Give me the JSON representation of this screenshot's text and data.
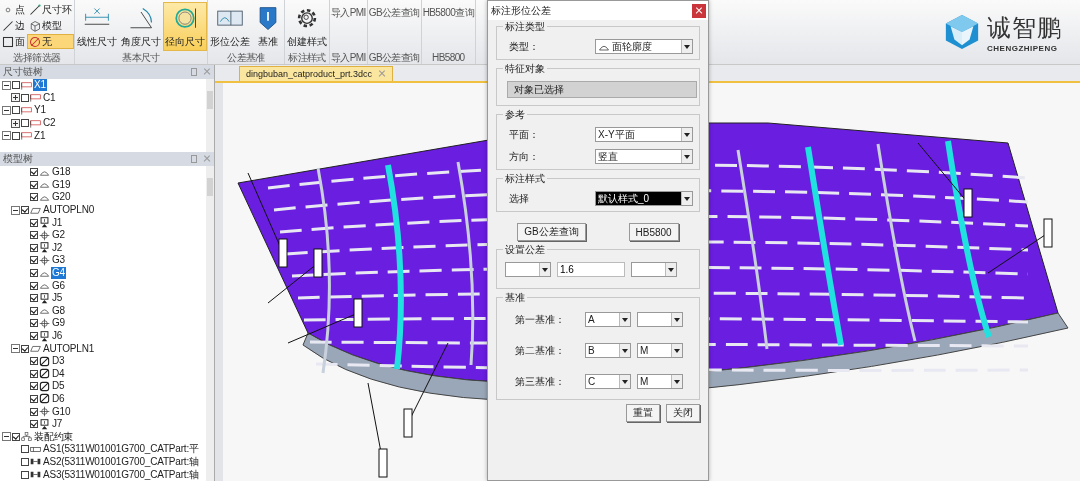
{
  "ribbon": {
    "groups": [
      {
        "label": "选择筛选器",
        "kind": "filter",
        "items": [
          {
            "label": "点",
            "kind": "point",
            "selected": false
          },
          {
            "label": "尺寸环",
            "kind": "line",
            "selected": false
          },
          {
            "label": "边",
            "kind": "edge",
            "selected": false
          },
          {
            "label": "模型",
            "kind": "cube",
            "selected": false
          },
          {
            "label": "面",
            "kind": "face",
            "selected": false
          },
          {
            "label": "无",
            "kind": "none",
            "selected": true
          }
        ]
      },
      {
        "label": "基本尺寸",
        "kind": "large",
        "items": [
          {
            "label": "线性尺寸",
            "kind": "linear",
            "selected": false
          },
          {
            "label": "角度尺寸",
            "kind": "angle",
            "selected": false
          },
          {
            "label": "径向尺寸",
            "kind": "radial",
            "selected": true
          }
        ]
      },
      {
        "label": "公差基准",
        "kind": "large",
        "items": [
          {
            "label": "形位公差",
            "kind": "tolerance",
            "selected": false
          },
          {
            "label": "基准",
            "kind": "datum",
            "selected": false
          }
        ]
      },
      {
        "label": "标注样式",
        "kind": "large",
        "items": [
          {
            "label": "创建样式",
            "kind": "gear",
            "selected": false
          }
        ]
      },
      {
        "label": "导入PMI",
        "kind": "text",
        "items": [
          {
            "label": "导入PMI"
          }
        ]
      },
      {
        "label": "GB公差查询",
        "kind": "text",
        "items": [
          {
            "label": "GB公差查询"
          }
        ]
      },
      {
        "label": "HB5800",
        "kind": "text",
        "items": [
          {
            "label": "HB5800查询"
          }
        ]
      }
    ]
  },
  "logo": {
    "name": "诚智鹏",
    "subtitle": "CHENGZHIPENG"
  },
  "dimension_tree": {
    "title": "尺寸链树",
    "items": [
      {
        "label": "X1",
        "kind": "flag",
        "checked": false,
        "selected": true,
        "expanded": true,
        "children": [
          {
            "label": "C1",
            "kind": "flag",
            "checked": false,
            "selected": false,
            "expanded": false
          }
        ]
      },
      {
        "label": "Y1",
        "kind": "flag",
        "checked": false,
        "selected": false,
        "expanded": true,
        "children": [
          {
            "label": "C2",
            "kind": "flag",
            "checked": false,
            "selected": false,
            "expanded": false
          }
        ]
      },
      {
        "label": "Z1",
        "kind": "flag",
        "checked": false,
        "selected": false,
        "expanded": true
      }
    ]
  },
  "model_tree": {
    "title": "模型树",
    "items": [
      {
        "children": [
          {
            "children": [
              {
                "label": "G18",
                "kind": "profile",
                "checked": true,
                "selected": false
              },
              {
                "label": "G19",
                "kind": "profile",
                "checked": true,
                "selected": false
              },
              {
                "label": "G20",
                "kind": "profile",
                "checked": true,
                "selected": false
              }
            ]
          },
          {
            "label": "AUTOPLN0",
            "kind": "plane",
            "checked": true,
            "selected": false,
            "expanded": true,
            "children": [
              {
                "label": "J1",
                "kind": "datum",
                "checked": true,
                "selected": false
              },
              {
                "label": "G2",
                "kind": "position",
                "checked": true,
                "selected": false
              },
              {
                "label": "J2",
                "kind": "datum",
                "checked": true,
                "selected": false
              },
              {
                "label": "G3",
                "kind": "position",
                "checked": true,
                "selected": false
              },
              {
                "label": "G4",
                "kind": "profile",
                "checked": true,
                "selected": true
              },
              {
                "label": "G6",
                "kind": "profile",
                "checked": true,
                "selected": false
              },
              {
                "label": "J5",
                "kind": "datum",
                "checked": true,
                "selected": false
              },
              {
                "label": "G8",
                "kind": "profile",
                "checked": true,
                "selected": false
              },
              {
                "label": "G9",
                "kind": "position",
                "checked": true,
                "selected": false
              },
              {
                "label": "J6",
                "kind": "datum",
                "checked": true,
                "selected": false
              }
            ]
          },
          {
            "label": "AUTOPLN1",
            "kind": "plane",
            "checked": true,
            "selected": false,
            "expanded": true,
            "children": [
              {
                "label": "D3",
                "kind": "flatness",
                "checked": true,
                "selected": false
              },
              {
                "label": "D4",
                "kind": "flatness",
                "checked": true,
                "selected": false
              },
              {
                "label": "D5",
                "kind": "flatness",
                "checked": true,
                "selected": false
              },
              {
                "label": "D6",
                "kind": "flatness",
                "checked": true,
                "selected": false
              },
              {
                "label": "G10",
                "kind": "position",
                "checked": true,
                "selected": false
              },
              {
                "label": "J7",
                "kind": "datum",
                "checked": true,
                "selected": false
              }
            ]
          }
        ]
      },
      {
        "label": "装配约束",
        "kind": "assembly",
        "checked": true,
        "selected": false,
        "expanded": true,
        "children": [
          {
            "label": "AS1(5311W01001G700_CATPart:平",
            "kind": "flat_constraint",
            "checked": false,
            "selected": false
          },
          {
            "label": "AS2(5311W01001G700_CATPart:轴",
            "kind": "axis_constraint",
            "checked": false,
            "selected": false
          },
          {
            "label": "AS3(5311W01001G700_CATPart:轴",
            "kind": "axis_constraint",
            "checked": false,
            "selected": false
          }
        ]
      }
    ]
  },
  "document_tab": {
    "label": "dingbuban_catproduct_prt.3dcc",
    "selected": true
  },
  "dialog": {
    "title": "标注形位公差",
    "annotation_type": {
      "title": "标注类型",
      "label": "类型：",
      "value": "面轮廓度"
    },
    "feature": {
      "title": "特征对象",
      "button": "对象已选择"
    },
    "reference": {
      "title": "参考",
      "rows": [
        {
          "label": "平面：",
          "value": "X-Y平面"
        },
        {
          "label": "方向：",
          "value": "竖直"
        }
      ]
    },
    "style": {
      "title": "标注样式",
      "label": "选择",
      "value": "默认样式_0",
      "highlighted": true
    },
    "query_buttons": [
      "GB公差查询",
      "HB5800"
    ],
    "tolerance": {
      "title": "设置公差",
      "value": "1.6"
    },
    "datums": {
      "title": "基准",
      "rows": [
        {
          "label": "第一基准：",
          "datum": "A"
        },
        {
          "label": "第二基准：",
          "datum": "B",
          "modifier": "M"
        },
        {
          "label": "第三基准：",
          "datum": "C",
          "modifier": "M"
        }
      ]
    },
    "buttons": [
      "重置",
      "关闭"
    ]
  }
}
